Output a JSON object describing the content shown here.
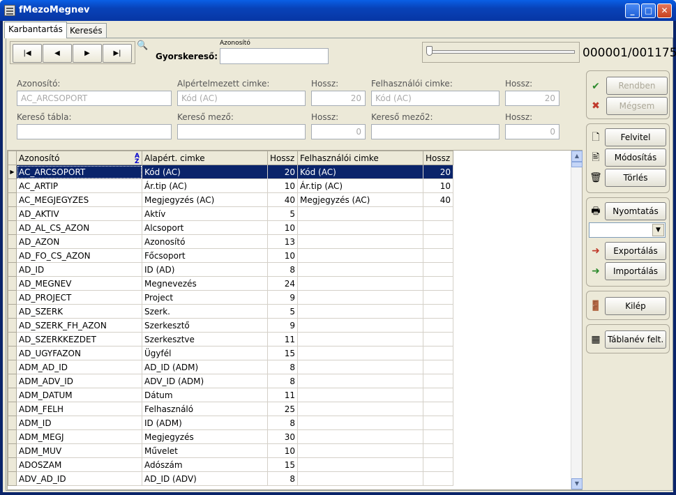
{
  "window": {
    "title": "fMezoMegnev",
    "minimize": "_",
    "maximize": "□",
    "close": "✕"
  },
  "tabs": [
    {
      "label": "Karbantartás",
      "active": true
    },
    {
      "label": "Keresés",
      "active": false
    }
  ],
  "nav": {
    "first": "|◀",
    "prev": "◀",
    "next": "▶",
    "last": "▶|"
  },
  "quicksearch": {
    "label": "Gyorskereső:",
    "caption": "Azonosító",
    "value": ""
  },
  "record_counter": "000001/001175",
  "progress": {
    "fraction": 0.0
  },
  "form": {
    "azonosito": {
      "label": "Azonosító:",
      "value": "AC_ARCSOPORT"
    },
    "alapertelmezett": {
      "label": "Alpértelmezett cimke:",
      "value": "Kód (AC)"
    },
    "hossz1": {
      "label": "Hossz:",
      "value": "20"
    },
    "felhasznaloi": {
      "label": "Felhasználói cimke:",
      "value": "Kód (AC)"
    },
    "hossz2": {
      "label": "Hossz:",
      "value": "20"
    },
    "kereso_tabla": {
      "label": "Kereső tábla:",
      "value": ""
    },
    "kereso_mezo": {
      "label": "Kereső mező:",
      "value": ""
    },
    "hossz3": {
      "label": "Hossz:",
      "value": "0"
    },
    "kereso_mezo2": {
      "label": "Kereső mező2:",
      "value": ""
    },
    "hossz4": {
      "label": "Hossz:",
      "value": "0"
    }
  },
  "grid": {
    "headers": [
      "Azonosító",
      "Alapért. cimke",
      "Hossz",
      "Felhasználói cimke",
      "Hossz"
    ],
    "sort_icon": "A↓Z",
    "rows": [
      [
        "AC_ARCSOPORT",
        "Kód (AC)",
        "20",
        "Kód (AC)",
        "20"
      ],
      [
        "AC_ARTIP",
        "Ár.tip (AC)",
        "10",
        "Ár.tip (AC)",
        "10"
      ],
      [
        "AC_MEGJEGYZES",
        "Megjegyzés (AC)",
        "40",
        "Megjegyzés (AC)",
        "40"
      ],
      [
        "AD_AKTIV",
        "Aktív",
        "5",
        "",
        ""
      ],
      [
        "AD_AL_CS_AZON",
        "Alcsoport",
        "10",
        "",
        ""
      ],
      [
        "AD_AZON",
        "Azonosító",
        "13",
        "",
        ""
      ],
      [
        "AD_FO_CS_AZON",
        "Főcsoport",
        "10",
        "",
        ""
      ],
      [
        "AD_ID",
        "ID (AD)",
        "8",
        "",
        ""
      ],
      [
        "AD_MEGNEV",
        "Megnevezés",
        "24",
        "",
        ""
      ],
      [
        "AD_PROJECT",
        "Project",
        "9",
        "",
        ""
      ],
      [
        "AD_SZERK",
        "Szerk.",
        "5",
        "",
        ""
      ],
      [
        "AD_SZERK_FH_AZON",
        "Szerkesztő",
        "9",
        "",
        ""
      ],
      [
        "AD_SZERKKEZDET",
        "Szerkesztve",
        "11",
        "",
        ""
      ],
      [
        "AD_UGYFAZON",
        "Ügyfél",
        "15",
        "",
        ""
      ],
      [
        "ADM_AD_ID",
        "AD_ID (ADM)",
        "8",
        "",
        ""
      ],
      [
        "ADM_ADV_ID",
        "ADV_ID (ADM)",
        "8",
        "",
        ""
      ],
      [
        "ADM_DATUM",
        "Dátum",
        "11",
        "",
        ""
      ],
      [
        "ADM_FELH",
        "Felhasználó",
        "25",
        "",
        ""
      ],
      [
        "ADM_ID",
        "ID (ADM)",
        "8",
        "",
        ""
      ],
      [
        "ADM_MEGJ",
        "Megjegyzés",
        "30",
        "",
        ""
      ],
      [
        "ADM_MUV",
        "Művelet",
        "10",
        "",
        ""
      ],
      [
        "ADOSZAM",
        "Adószám",
        "15",
        "",
        ""
      ],
      [
        "ADV_AD_ID",
        "AD_ID (ADV)",
        "8",
        "",
        ""
      ]
    ]
  },
  "sidebar": {
    "rendben": "Rendben",
    "megsem": "Mégsem",
    "felvitel": "Felvitel",
    "modositas": "Módosítás",
    "torles": "Törlés",
    "nyomtatas": "Nyomtatás",
    "select_value": "",
    "exportalas": "Exportálás",
    "importalas": "Importálás",
    "kilep": "Kilép",
    "tablanev": "Táblanév felt."
  },
  "colors": {
    "selection": "#0a246a",
    "ok_check": "#2e8b2e",
    "cancel_x": "#c0392b"
  }
}
